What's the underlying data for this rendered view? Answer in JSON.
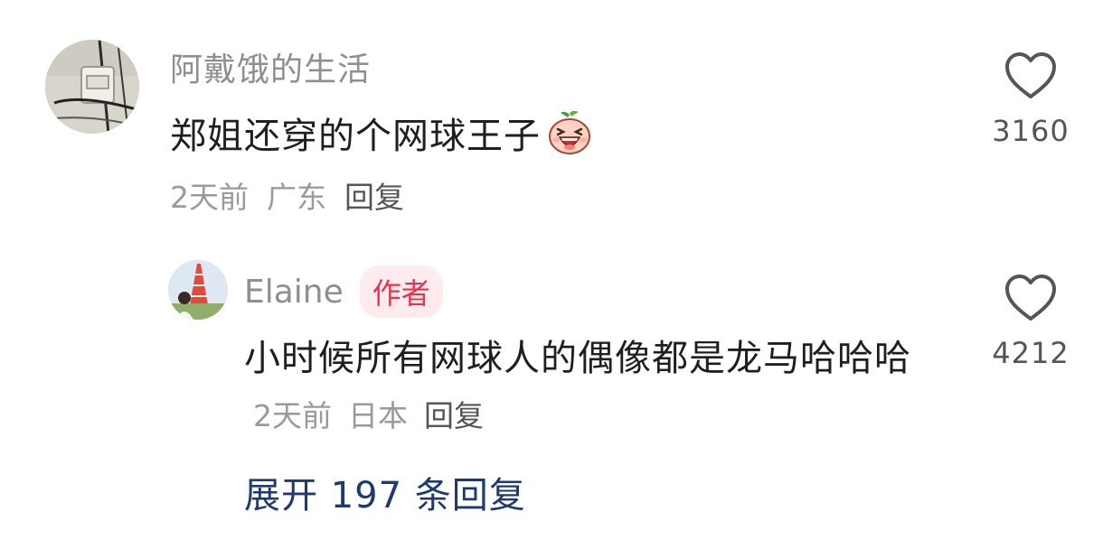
{
  "comment": {
    "username": "阿戴饿的生活",
    "text": "郑姐还穿的个网球王子",
    "sticker_icon": "laughing-sticker-icon",
    "time": "2天前",
    "location": "广东",
    "reply_label": "回复",
    "like_count": "3160"
  },
  "reply": {
    "username": "Elaine",
    "badge": "作者",
    "text": "小时候所有网球人的偶像都是龙马哈哈哈",
    "time": "2天前",
    "location": "日本",
    "reply_label": "回复",
    "like_count": "4212"
  },
  "expand": {
    "label": "展开 197 条回复"
  },
  "colors": {
    "badge_text": "#e8324b",
    "badge_bg": "#fdebed",
    "expand_link": "#1e3a6e",
    "meta_gray": "#9a9a9a"
  }
}
